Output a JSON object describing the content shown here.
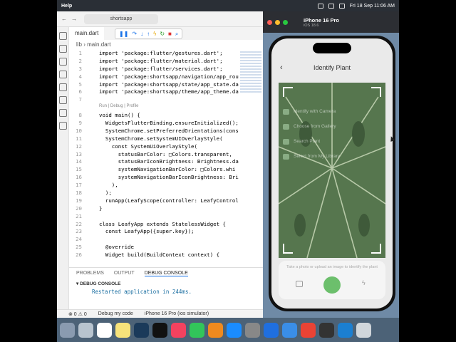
{
  "menubar": {
    "help": "Help",
    "datetime": "Fri 18 Sep  11:06 AM"
  },
  "vscode": {
    "search": "shortsapp",
    "tab": "main.dart",
    "breadcrumb": [
      "lib",
      "main.dart"
    ],
    "code": [
      {
        "n": "1",
        "t": "import 'package:flutter/gestures.dart';"
      },
      {
        "n": "2",
        "t": "import 'package:flutter/material.dart';"
      },
      {
        "n": "3",
        "t": "import 'package:flutter/services.dart';"
      },
      {
        "n": "4",
        "t": "import 'package:shortsapp/navigation/app_rou"
      },
      {
        "n": "5",
        "t": "import 'package:shortsapp/state/app_state.da"
      },
      {
        "n": "6",
        "t": "import 'package:shortsapp/theme/app_theme.da"
      },
      {
        "n": "7",
        "t": ""
      },
      {
        "n": "",
        "t": "Run | Debug | Profile",
        "lens": true
      },
      {
        "n": "8",
        "t": "void main() {"
      },
      {
        "n": "9",
        "t": "  WidgetsFlutterBinding.ensureInitialized();"
      },
      {
        "n": "10",
        "t": "  SystemChrome.setPreferredOrientations(cons"
      },
      {
        "n": "11",
        "t": "  SystemChrome.setSystemUIOverlayStyle("
      },
      {
        "n": "12",
        "t": "    const SystemUiOverlayStyle("
      },
      {
        "n": "13",
        "t": "      statusBarColor: □Colors.transparent,"
      },
      {
        "n": "14",
        "t": "      statusBarIconBrightness: Brightness.da"
      },
      {
        "n": "15",
        "t": "      systemNavigationBarColor: □Colors.whi"
      },
      {
        "n": "16",
        "t": "      systemNavigationBarIconBrightness: Bri"
      },
      {
        "n": "17",
        "t": "    ),"
      },
      {
        "n": "18",
        "t": "  );"
      },
      {
        "n": "19",
        "t": "  runApp(LeafyScope(controller: LeafyControl"
      },
      {
        "n": "20",
        "t": "}"
      },
      {
        "n": "21",
        "t": ""
      },
      {
        "n": "22",
        "t": "class LeafyApp extends StatelessWidget {"
      },
      {
        "n": "23",
        "t": "  const LeafyApp({super.key});"
      },
      {
        "n": "24",
        "t": ""
      },
      {
        "n": "25",
        "t": "  @override"
      },
      {
        "n": "26",
        "t": "  Widget build(BuildContext context) {"
      }
    ],
    "panel_tabs": [
      "PROBLEMS",
      "OUTPUT",
      "DEBUG CONSOLE"
    ],
    "debug_console_header": "DEBUG CONSOLE",
    "debug_message": "Restarted application in 244ms.",
    "status": {
      "problems": "⊗ 0  ⚠ 0",
      "debug": "Debug my code",
      "device": "iPhone 16 Pro (ios simulator)"
    }
  },
  "simulator": {
    "device": "iPhone 16 Pro",
    "os": "iOS 18.6",
    "screen_title": "Identify Plant",
    "options": [
      "Identify with Camera",
      "Choose from Gallery",
      "Search Plant",
      "Select from My Library"
    ],
    "hint": "Take a photo or upload an image to identify the plant"
  },
  "colors": {
    "accent": "#6cbf6c",
    "leaf": "#5a7a52"
  }
}
